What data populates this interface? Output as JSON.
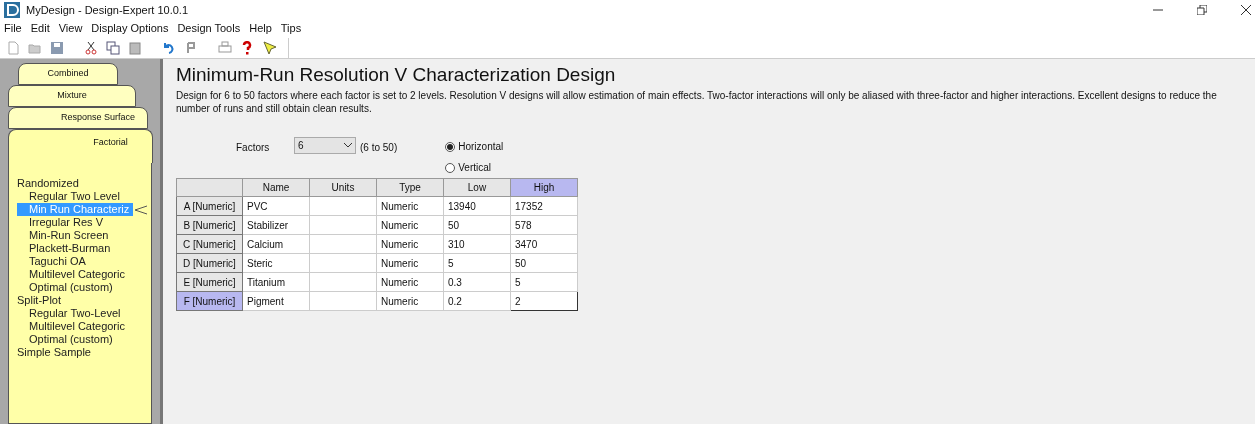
{
  "window": {
    "title": "MyDesign - Design-Expert 10.0.1"
  },
  "menu": [
    "File",
    "Edit",
    "View",
    "Display Options",
    "Design Tools",
    "Help",
    "Tips"
  ],
  "tabs": [
    {
      "label": "Combined",
      "selected": false
    },
    {
      "label": "Mixture",
      "selected": false
    },
    {
      "label": "Response Surface",
      "selected": false
    },
    {
      "label": "Factorial",
      "selected": true
    }
  ],
  "sidebar": {
    "items": [
      {
        "label": "Randomized",
        "selected": false,
        "children": [
          {
            "label": "Regular Two Level",
            "selected": false
          },
          {
            "label": "Min Run Characteriz",
            "selected": true
          },
          {
            "label": "Irregular Res V",
            "selected": false
          },
          {
            "label": "Min-Run Screen",
            "selected": false
          },
          {
            "label": "Plackett-Burman",
            "selected": false
          },
          {
            "label": "Taguchi OA",
            "selected": false
          },
          {
            "label": "Multilevel Categoric",
            "selected": false
          },
          {
            "label": "Optimal (custom)",
            "selected": false
          }
        ]
      },
      {
        "label": "Split-Plot",
        "selected": false,
        "children": [
          {
            "label": "Regular Two-Level",
            "selected": false
          },
          {
            "label": "Multilevel Categoric",
            "selected": false
          },
          {
            "label": "Optimal (custom)",
            "selected": false
          }
        ]
      },
      {
        "label": "Simple Sample",
        "selected": false
      }
    ]
  },
  "heading": "Minimum-Run Resolution V Characterization Design",
  "description": "Design for 6 to 50 factors where each factor is set to 2 levels. Resolution V designs will allow estimation of main effects. Two-factor interactions will only be aliased with three-factor and higher interactions. Excellent designs to reduce the number of runs and still obtain clean results.",
  "factors": {
    "label": "Factors",
    "value": "6",
    "range": "(6 to 50)"
  },
  "orientation": [
    {
      "label": "Horizontal",
      "selected": true
    },
    {
      "label": "Vertical",
      "selected": false
    }
  ],
  "table": {
    "columns": [
      {
        "label": "Name",
        "selected": false
      },
      {
        "label": "Units",
        "selected": false
      },
      {
        "label": "Type",
        "selected": false
      },
      {
        "label": "Low",
        "selected": false
      },
      {
        "label": "High",
        "selected": true
      }
    ],
    "rows": [
      {
        "header": "A [Numeric]",
        "selected": false,
        "editing": false,
        "cells": [
          "PVC",
          "",
          "Numeric",
          "13940",
          "17352"
        ]
      },
      {
        "header": "B [Numeric]",
        "selected": false,
        "editing": false,
        "cells": [
          "Stabilizer",
          "",
          "Numeric",
          "50",
          "578"
        ]
      },
      {
        "header": "C [Numeric]",
        "selected": false,
        "editing": false,
        "cells": [
          "Calcium",
          "",
          "Numeric",
          "310",
          "3470"
        ]
      },
      {
        "header": "D [Numeric]",
        "selected": false,
        "editing": false,
        "cells": [
          "Steric",
          "",
          "Numeric",
          "5",
          "50"
        ]
      },
      {
        "header": "E [Numeric]",
        "selected": false,
        "editing": false,
        "cells": [
          "Titanium",
          "",
          "Numeric",
          "0.3",
          "5"
        ]
      },
      {
        "header": "F [Numeric]",
        "selected": true,
        "editing": true,
        "cells": [
          "Pigment",
          "",
          "Numeric",
          "0.2",
          "2"
        ]
      }
    ]
  }
}
